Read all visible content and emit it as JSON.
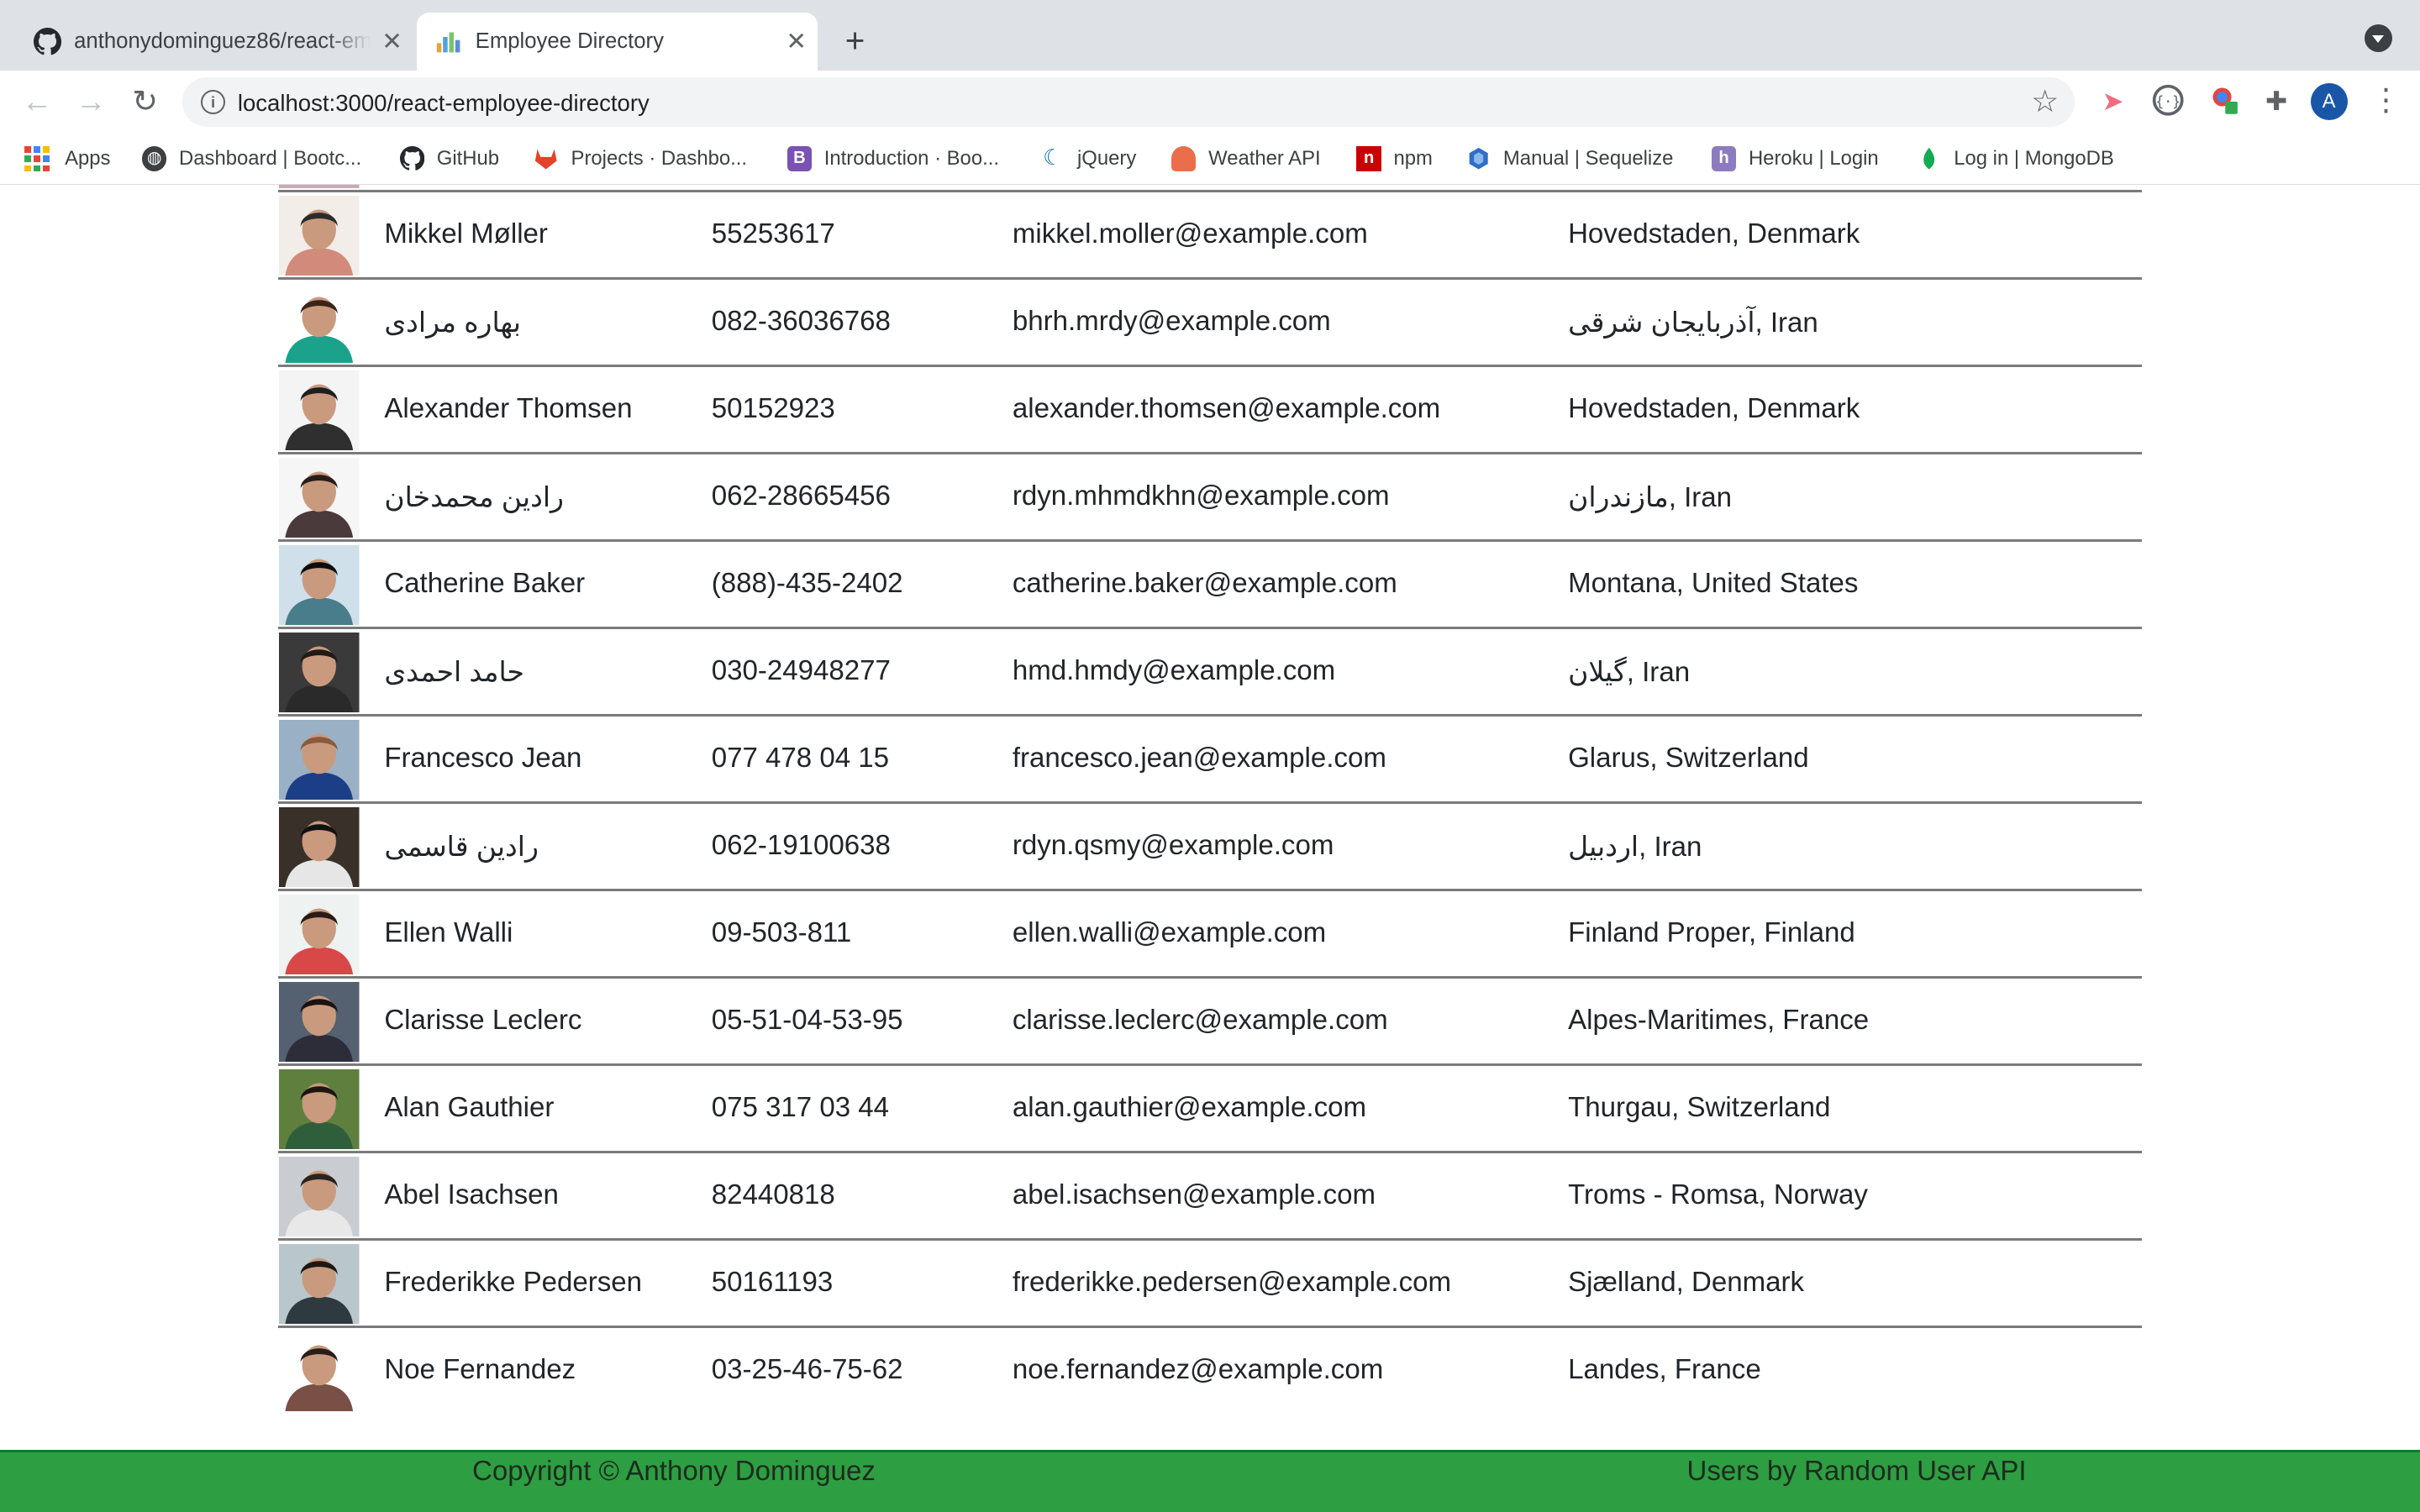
{
  "browser": {
    "tabs": [
      {
        "title": "anthonydominguez86/react-employee-directory",
        "active": false,
        "icon": "github-icon"
      },
      {
        "title": "Employee Directory",
        "active": true,
        "icon": "react-icon"
      }
    ],
    "url": "localhost:3000/react-employee-directory",
    "profile_initial": "A",
    "bookmarks": [
      {
        "label": "Apps",
        "icon": "apps-grid-icon"
      },
      {
        "label": "Dashboard | Bootc...",
        "icon": "globe-icon"
      },
      {
        "label": "GitHub",
        "icon": "github-icon"
      },
      {
        "label": "Projects · Dashbo...",
        "icon": "gitlab-icon"
      },
      {
        "label": "Introduction · Boo...",
        "icon": "bootstrap-icon"
      },
      {
        "label": "jQuery",
        "icon": "jquery-icon"
      },
      {
        "label": "Weather API",
        "icon": "weather-icon"
      },
      {
        "label": "npm",
        "icon": "npm-icon"
      },
      {
        "label": "Manual | Sequelize",
        "icon": "sequelize-icon"
      },
      {
        "label": "Heroku | Login",
        "icon": "heroku-icon"
      },
      {
        "label": "Log in | MongoDB",
        "icon": "mongodb-icon"
      }
    ]
  },
  "employees": [
    {
      "name": "Mikkel Møller",
      "phone": "55253617",
      "email": "mikkel.moller@example.com",
      "location": "Hovedstaden, Denmark"
    },
    {
      "name": "بهاره مرادی",
      "phone": "082-36036768",
      "email": "bhrh.mrdy@example.com",
      "location": "آذربایجان شرقی, Iran"
    },
    {
      "name": "Alexander Thomsen",
      "phone": "50152923",
      "email": "alexander.thomsen@example.com",
      "location": "Hovedstaden, Denmark"
    },
    {
      "name": "رادین محمدخان",
      "phone": "062-28665456",
      "email": "rdyn.mhmdkhn@example.com",
      "location": "مازندران, Iran"
    },
    {
      "name": "Catherine Baker",
      "phone": "(888)-435-2402",
      "email": "catherine.baker@example.com",
      "location": "Montana, United States"
    },
    {
      "name": "حامد احمدی",
      "phone": "030-24948277",
      "email": "hmd.hmdy@example.com",
      "location": "گیلان, Iran"
    },
    {
      "name": "Francesco Jean",
      "phone": "077 478 04 15",
      "email": "francesco.jean@example.com",
      "location": "Glarus, Switzerland"
    },
    {
      "name": "رادین قاسمی",
      "phone": "062-19100638",
      "email": "rdyn.qsmy@example.com",
      "location": "اردبیل, Iran"
    },
    {
      "name": "Ellen Walli",
      "phone": "09-503-811",
      "email": "ellen.walli@example.com",
      "location": "Finland Proper, Finland"
    },
    {
      "name": "Clarisse Leclerc",
      "phone": "05-51-04-53-95",
      "email": "clarisse.leclerc@example.com",
      "location": "Alpes-Maritimes, France"
    },
    {
      "name": "Alan Gauthier",
      "phone": "075 317 03 44",
      "email": "alan.gauthier@example.com",
      "location": "Thurgau, Switzerland"
    },
    {
      "name": "Abel Isachsen",
      "phone": "82440818",
      "email": "abel.isachsen@example.com",
      "location": "Troms - Romsa, Norway"
    },
    {
      "name": "Frederikke Pedersen",
      "phone": "50161193",
      "email": "frederikke.pedersen@example.com",
      "location": "Sjælland, Denmark"
    },
    {
      "name": "Noe Fernandez",
      "phone": "03-25-46-75-62",
      "email": "noe.fernandez@example.com",
      "location": "Landes, France"
    }
  ],
  "footer": {
    "copyright": "Copyright © Anthony Dominguez",
    "credit": "Users by Random User API"
  },
  "colors": {
    "footer_bg": "#2e9e42",
    "row_divider": "#7a7a7a"
  }
}
